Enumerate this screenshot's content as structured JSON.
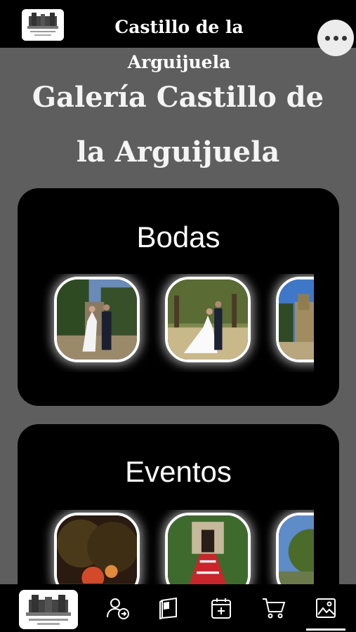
{
  "header": {
    "app_title": "Castillo de la Arguijuela",
    "logo_icon": "castle-logo-icon",
    "more_icon": "more-dots-icon"
  },
  "page": {
    "title": "Galería Castillo de la Arguijuela"
  },
  "galleries": [
    {
      "title": "Bodas",
      "photos": [
        "wedding-photo-1",
        "wedding-photo-2",
        "wedding-photo-3"
      ]
    },
    {
      "title": "Eventos",
      "photos": [
        "event-photo-1",
        "event-photo-2",
        "event-photo-3"
      ]
    }
  ],
  "bottom_nav": {
    "items": [
      {
        "icon": "castle-logo-icon"
      },
      {
        "icon": "user-share-icon"
      },
      {
        "icon": "book-icon"
      },
      {
        "icon": "calendar-add-icon"
      },
      {
        "icon": "cart-icon"
      },
      {
        "icon": "gallery-icon",
        "active": true
      }
    ]
  },
  "colors": {
    "background": "#5e5e5e",
    "bars": "#000000",
    "card": "#000000",
    "text": "#ffffff"
  }
}
